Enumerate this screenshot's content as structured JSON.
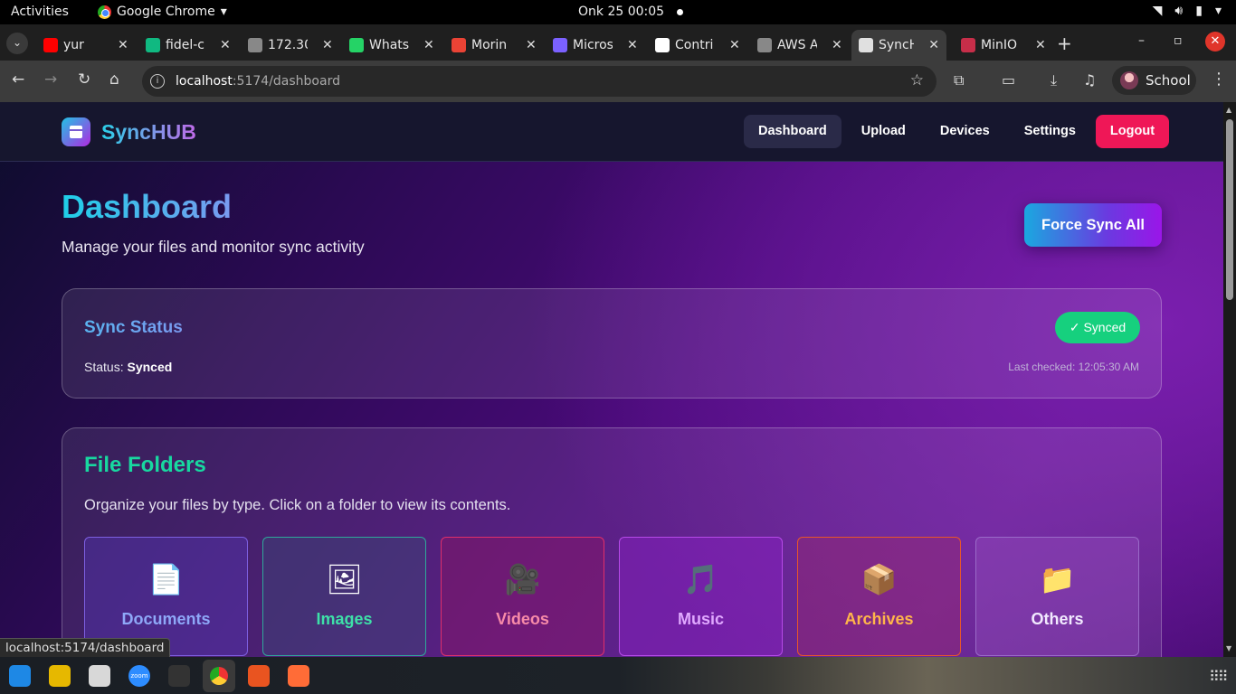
{
  "system": {
    "activities": "Activities",
    "app_menu": "Google Chrome",
    "clock": "Onk 25  00:05",
    "icons": [
      "wifi-icon",
      "volume-icon",
      "battery-icon",
      "power-menu-icon"
    ]
  },
  "browser": {
    "tabs": [
      {
        "label": "yur",
        "icon": "youtube-icon",
        "color": "#ff0000"
      },
      {
        "label": "fidel-c",
        "icon": "deploy-icon",
        "color": "#10b981"
      },
      {
        "label": "172.30",
        "icon": "globe-icon",
        "color": "#888888"
      },
      {
        "label": "Whats",
        "icon": "whatsapp-icon",
        "color": "#25d366"
      },
      {
        "label": "Morin",
        "icon": "gmail-icon",
        "color": "#ea4335"
      },
      {
        "label": "Micros",
        "icon": "copilot-icon",
        "color": "#7b61ff"
      },
      {
        "label": "Contri",
        "icon": "github-icon",
        "color": "#ffffff"
      },
      {
        "label": "AWS A",
        "icon": "globe-icon",
        "color": "#888888"
      },
      {
        "label": "SyncH",
        "icon": "synchub-icon",
        "color": "#e0e0e0"
      },
      {
        "label": "MinIO",
        "icon": "minio-icon",
        "color": "#c72e49"
      }
    ],
    "url_host": "localhost",
    "url_path": ":5174/dashboard",
    "profile_name": "School",
    "status_url": "localhost:5174/dashboard"
  },
  "app": {
    "brand": "SyncHUB",
    "nav": {
      "dashboard": "Dashboard",
      "upload": "Upload",
      "devices": "Devices",
      "settings": "Settings",
      "logout": "Logout"
    },
    "title": "Dashboard",
    "subtitle": "Manage your files and monitor sync activity",
    "force_sync": "Force Sync All",
    "sync_status": {
      "heading": "Sync Status",
      "status_label": "Status:",
      "status_value": "Synced",
      "badge": "✓ Synced",
      "last_checked": "Last checked: 12:05:30 AM"
    },
    "folders": {
      "heading": "File Folders",
      "description": "Organize your files by type. Click on a folder to view its contents.",
      "items": [
        {
          "label": "Documents",
          "icon": "document-icon",
          "glyph": "📄",
          "color": "#8ea8f8",
          "border": "#7d5fe0",
          "bg": "rgba(90,60,200,0.35)"
        },
        {
          "label": "Images",
          "icon": "image-icon",
          "glyph": "🖼",
          "color": "#3ee0a8",
          "border": "#2fa89a",
          "bg": "rgba(60,70,120,0.45)"
        },
        {
          "label": "Videos",
          "icon": "video-camera-icon",
          "glyph": "🎥",
          "color": "#f78aa8",
          "border": "#e0306a",
          "bg": "rgba(140,20,100,0.45)"
        },
        {
          "label": "Music",
          "icon": "music-icon",
          "glyph": "🎵",
          "color": "#e0a8ff",
          "border": "#b64ae8",
          "bg": "rgba(140,30,200,0.45)"
        },
        {
          "label": "Archives",
          "icon": "package-icon",
          "glyph": "📦",
          "color": "#ffb54a",
          "border": "#e8562a",
          "bg": "rgba(150,40,110,0.45)"
        },
        {
          "label": "Others",
          "icon": "folder-icon",
          "glyph": "📁",
          "color": "#f2eaff",
          "border": "#9a6ac8",
          "bg": "rgba(150,80,190,0.4)"
        }
      ]
    }
  },
  "dock": {
    "apps": [
      "vscode-icon",
      "rhythmbox-icon",
      "files-icon",
      "zoom-icon",
      "terminal-icon",
      "chrome-icon",
      "software-icon",
      "postman-icon"
    ],
    "zoom_label": "zoom"
  }
}
